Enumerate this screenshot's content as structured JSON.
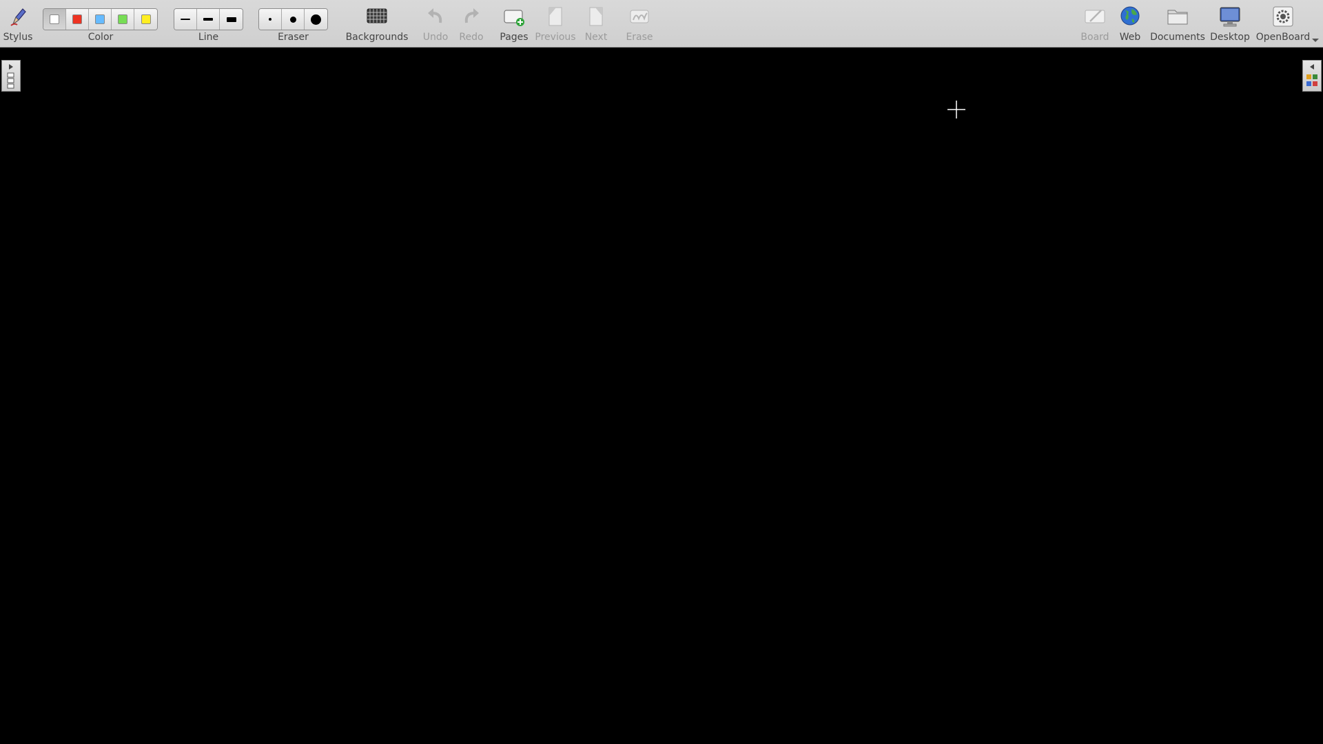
{
  "toolbar": {
    "stylus_label": "Stylus",
    "color_label": "Color",
    "line_label": "Line",
    "eraser_label": "Eraser",
    "backgrounds_label": "Backgrounds",
    "undo_label": "Undo",
    "redo_label": "Redo",
    "pages_label": "Pages",
    "previous_label": "Previous",
    "next_label": "Next",
    "erase_label": "Erase",
    "board_label": "Board",
    "web_label": "Web",
    "documents_label": "Documents",
    "desktop_label": "Desktop",
    "openboard_label": "OpenBoard"
  },
  "colors": [
    {
      "name": "white",
      "hex": "#ffffff",
      "selected": true
    },
    {
      "name": "red",
      "hex": "#ee3322"
    },
    {
      "name": "blue",
      "hex": "#66bbff"
    },
    {
      "name": "green",
      "hex": "#77dd55"
    },
    {
      "name": "yellow",
      "hex": "#ffee22"
    }
  ],
  "line_widths": [
    "thin",
    "medium",
    "thick"
  ],
  "eraser_sizes": [
    "small",
    "medium",
    "large"
  ],
  "icons": {
    "stylus": "stylus-icon",
    "backgrounds": "backgrounds-icon",
    "undo": "undo-icon",
    "redo": "redo-icon",
    "pages": "add-page-icon",
    "previous": "previous-page-icon",
    "next": "next-page-icon",
    "erase": "erase-icon",
    "board": "board-icon",
    "web": "globe-icon",
    "documents": "folder-icon",
    "desktop": "monitor-icon",
    "openboard": "gear-icon"
  },
  "board": {
    "background_color": "#000000"
  }
}
